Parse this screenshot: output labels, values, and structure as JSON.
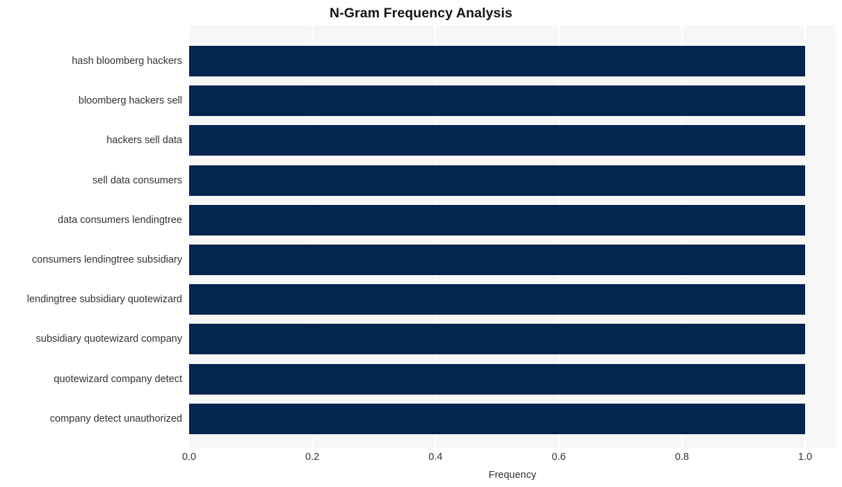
{
  "chart_data": {
    "type": "bar",
    "orientation": "horizontal",
    "title": "N-Gram Frequency Analysis",
    "xlabel": "Frequency",
    "ylabel": "",
    "xlim": [
      0.0,
      1.0
    ],
    "xticks": [
      "0.0",
      "0.2",
      "0.4",
      "0.6",
      "0.8",
      "1.0"
    ],
    "xtick_values": [
      0.0,
      0.2,
      0.4,
      0.6,
      0.8,
      1.0
    ],
    "grid": true,
    "grid_axis": "x",
    "legend": null,
    "bar_color": "#04254f",
    "plot_background": "#f7f7f7",
    "figure_background": "#ffffff",
    "categories": [
      "hash bloomberg hackers",
      "bloomberg hackers sell",
      "hackers sell data",
      "sell data consumers",
      "data consumers lendingtree",
      "consumers lendingtree subsidiary",
      "lendingtree subsidiary quotewizard",
      "subsidiary quotewizard company",
      "quotewizard company detect",
      "company detect unauthorized"
    ],
    "values": [
      1.0,
      1.0,
      1.0,
      1.0,
      1.0,
      1.0,
      1.0,
      1.0,
      1.0,
      1.0
    ]
  }
}
